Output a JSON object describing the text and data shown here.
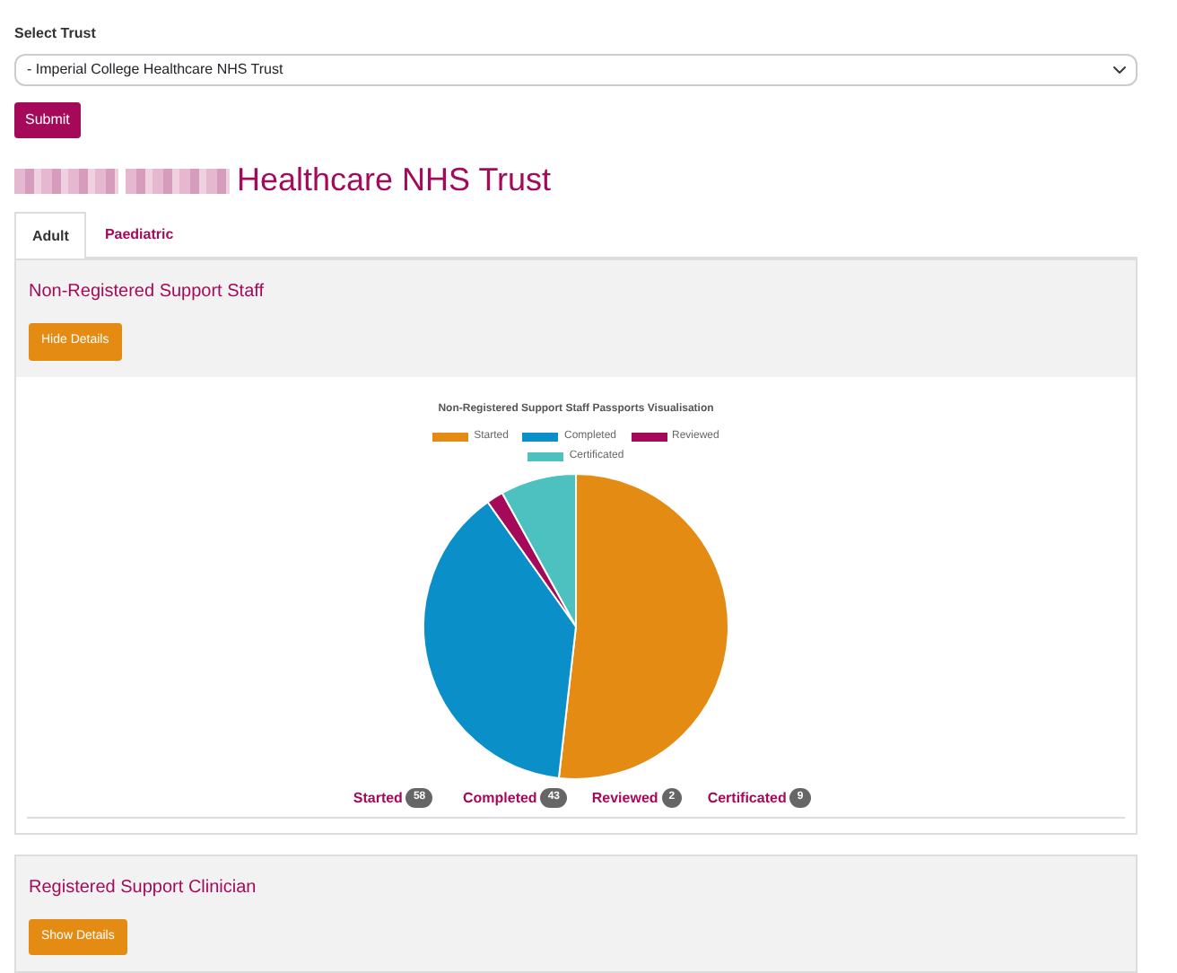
{
  "trust_select": {
    "label": "Select Trust",
    "value": "- Imperial College Healthcare NHS Trust"
  },
  "submit_button": "Submit",
  "heading": {
    "redacted": true,
    "text": "Healthcare NHS Trust"
  },
  "tabs": [
    {
      "label": "Adult",
      "selected": true
    },
    {
      "label": "Paediatric",
      "selected": false
    }
  ],
  "panels": [
    {
      "title": "Non-Registered Support Staff",
      "button": "Hide Details",
      "slice_colors": [
        {
          "color": "#e38b12"
        },
        {
          "color": "#0a8fc9"
        },
        {
          "color": "#a50a5a"
        },
        {
          "color": "#4cc1bf"
        }
      ],
      "chart_data": {
        "type": "pie",
        "title": "Non-Registered Support Staff Passports Visualisation",
        "categories": [
          "Started",
          "Completed",
          "Reviewed",
          "Certificated"
        ],
        "values": [
          51.79,
          38.39,
          1.79,
          8.03
        ],
        "legend": "top"
      },
      "counts": [
        {
          "label": "Started",
          "count": "58"
        },
        {
          "label": "Completed",
          "count": "43"
        },
        {
          "label": "Reviewed",
          "count": "2"
        },
        {
          "label": "Certificated",
          "count": "9"
        }
      ]
    },
    {
      "title": "Registered Support Clinician",
      "button": "Show Details"
    }
  ]
}
